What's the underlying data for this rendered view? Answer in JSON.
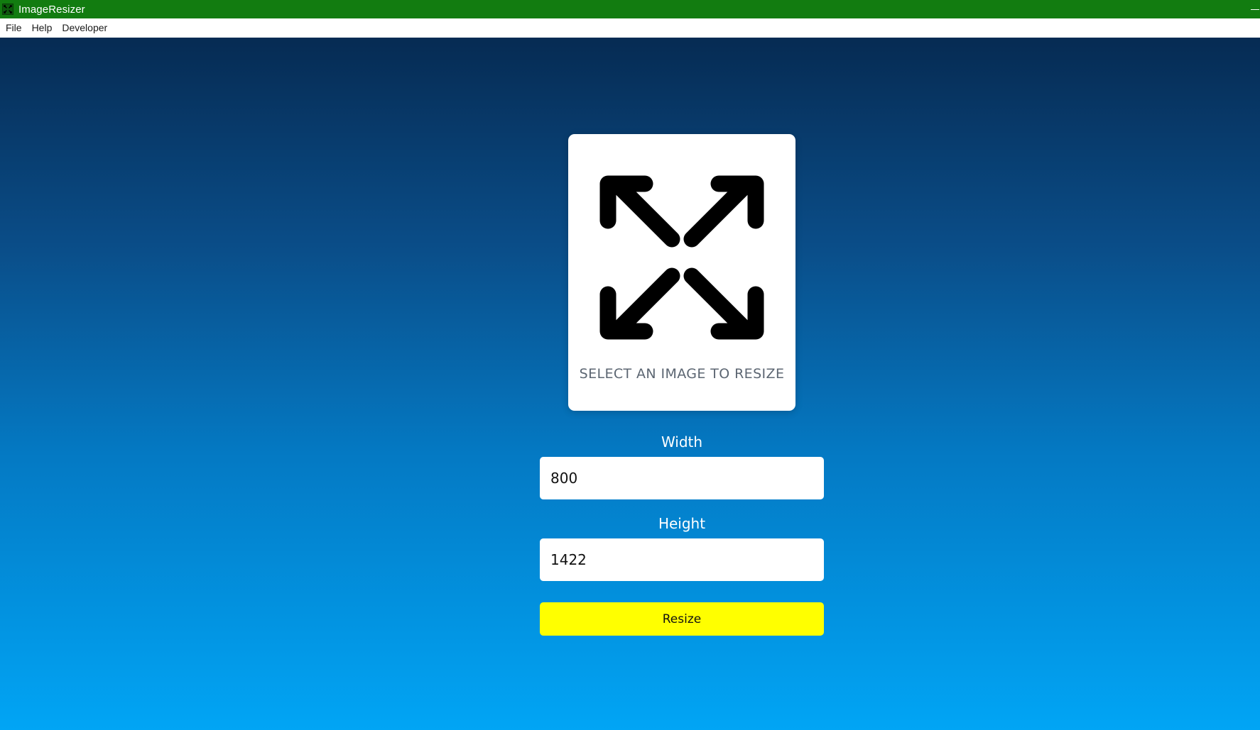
{
  "window": {
    "title": "ImageResizer",
    "app_icon": "expand-arrows-icon",
    "title_bar_color": "#127c10"
  },
  "menubar": {
    "items": [
      {
        "label": "File"
      },
      {
        "label": "Help"
      },
      {
        "label": "Developer"
      }
    ]
  },
  "drop_zone": {
    "icon": "expand-arrows-icon",
    "text": "SELECT AN IMAGE TO RESIZE"
  },
  "form": {
    "width": {
      "label": "Width",
      "value": "800"
    },
    "height": {
      "label": "Height",
      "value": "1422"
    },
    "submit_label": "Resize"
  },
  "colors": {
    "background_top": "#062b53",
    "background_bottom": "#01a5f5",
    "button": "#ffff00"
  }
}
